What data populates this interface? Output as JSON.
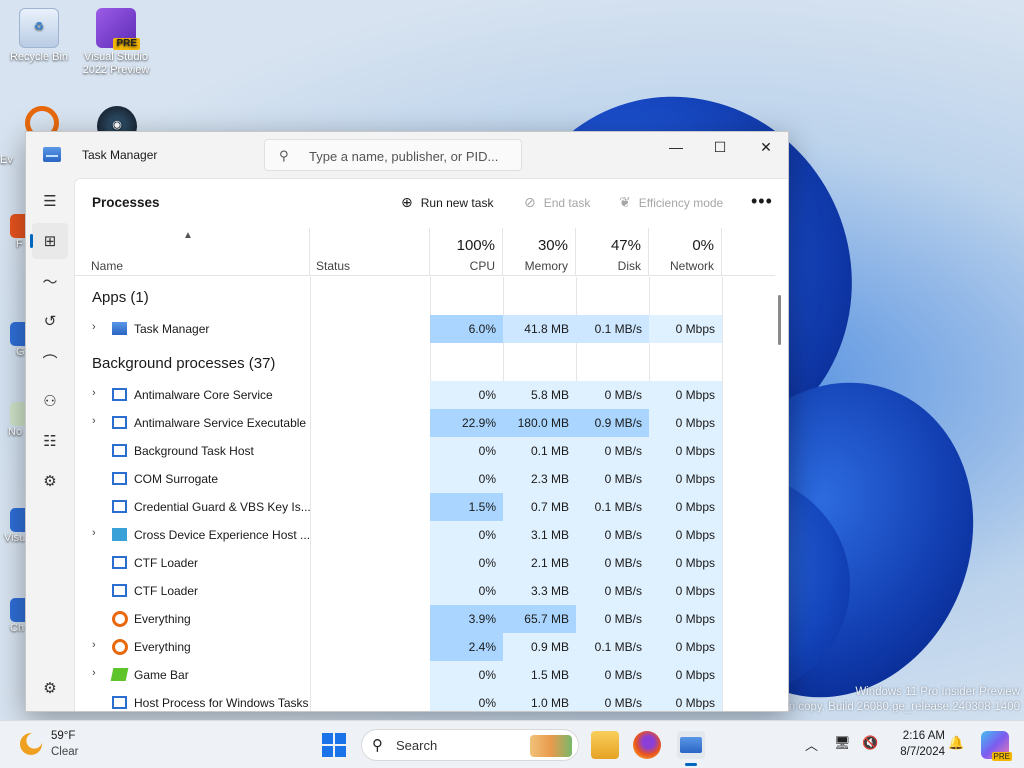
{
  "desktop": {
    "icons": [
      {
        "label": "Recycle Bin"
      },
      {
        "label": "Visual Studio 2022 Preview",
        "badge": "PRE"
      }
    ],
    "peek_labels": [
      "Ev",
      "F",
      "G",
      "No",
      "Visu",
      "Ch"
    ],
    "watermark": {
      "line1": "Windows 11 Pro Insider Preview",
      "line2": "n copy. Build 26080.ge_release.240308-1400"
    }
  },
  "window": {
    "title": "Task Manager",
    "search_placeholder": "Type a name, publisher, or PID...",
    "controls": {
      "minimize": "—",
      "maximize": "☐",
      "close": "✕"
    }
  },
  "sidebar": {
    "items": [
      {
        "icon": "hamburger-icon"
      },
      {
        "icon": "processes-icon",
        "active": true
      },
      {
        "icon": "performance-icon"
      },
      {
        "icon": "app-history-icon"
      },
      {
        "icon": "startup-apps-icon"
      },
      {
        "icon": "users-icon"
      },
      {
        "icon": "details-icon"
      },
      {
        "icon": "services-icon"
      },
      {
        "icon": "settings-icon"
      }
    ]
  },
  "toolbar": {
    "page_title": "Processes",
    "run_new_task": "Run new task",
    "end_task": "End task",
    "efficiency_mode": "Efficiency mode",
    "more": "•••"
  },
  "columns": {
    "name": "Name",
    "status": "Status",
    "cpu": {
      "pct": "100%",
      "label": "CPU"
    },
    "memory": {
      "pct": "30%",
      "label": "Memory"
    },
    "disk": {
      "pct": "47%",
      "label": "Disk"
    },
    "network": {
      "pct": "0%",
      "label": "Network"
    }
  },
  "sections": {
    "apps": "Apps (1)",
    "background": "Background processes (37)"
  },
  "apps": [
    {
      "name": "Task Manager",
      "expandable": true,
      "icon": "task-manager",
      "cpu": "6.0%",
      "memory": "41.8 MB",
      "disk": "0.1 MB/s",
      "network": "0 Mbps",
      "heat": [
        "#a9d5ff",
        "#cce7ff",
        "#cce7ff",
        "#dff0ff"
      ]
    }
  ],
  "background": [
    {
      "name": "Antimalware Core Service",
      "expandable": true,
      "icon": "window",
      "cpu": "0%",
      "memory": "5.8 MB",
      "disk": "0 MB/s",
      "network": "0 Mbps",
      "heat": [
        "#dff0ff",
        "#dff0ff",
        "#dff0ff",
        "#dff0ff"
      ]
    },
    {
      "name": "Antimalware Service Executable",
      "expandable": true,
      "icon": "window",
      "cpu": "22.9%",
      "memory": "180.0 MB",
      "disk": "0.9 MB/s",
      "network": "0 Mbps",
      "heat": [
        "#a9d5ff",
        "#a9d5ff",
        "#a9d5ff",
        "#dff0ff"
      ]
    },
    {
      "name": "Background Task Host",
      "expandable": false,
      "icon": "window",
      "cpu": "0%",
      "memory": "0.1 MB",
      "disk": "0 MB/s",
      "network": "0 Mbps",
      "heat": [
        "#dff0ff",
        "#dff0ff",
        "#dff0ff",
        "#dff0ff"
      ]
    },
    {
      "name": "COM Surrogate",
      "expandable": false,
      "icon": "window",
      "cpu": "0%",
      "memory": "2.3 MB",
      "disk": "0 MB/s",
      "network": "0 Mbps",
      "heat": [
        "#dff0ff",
        "#dff0ff",
        "#dff0ff",
        "#dff0ff"
      ]
    },
    {
      "name": "Credential Guard & VBS Key Is...",
      "expandable": false,
      "icon": "window",
      "cpu": "1.5%",
      "memory": "0.7 MB",
      "disk": "0.1 MB/s",
      "network": "0 Mbps",
      "heat": [
        "#a9d5ff",
        "#dff0ff",
        "#dff0ff",
        "#dff0ff"
      ]
    },
    {
      "name": "Cross Device Experience Host ...",
      "expandable": true,
      "icon": "cross-device",
      "cpu": "0%",
      "memory": "3.1 MB",
      "disk": "0 MB/s",
      "network": "0 Mbps",
      "heat": [
        "#dff0ff",
        "#dff0ff",
        "#dff0ff",
        "#dff0ff"
      ]
    },
    {
      "name": "CTF Loader",
      "expandable": false,
      "icon": "window",
      "cpu": "0%",
      "memory": "2.1 MB",
      "disk": "0 MB/s",
      "network": "0 Mbps",
      "heat": [
        "#dff0ff",
        "#dff0ff",
        "#dff0ff",
        "#dff0ff"
      ]
    },
    {
      "name": "CTF Loader",
      "expandable": false,
      "icon": "window",
      "cpu": "0%",
      "memory": "3.3 MB",
      "disk": "0 MB/s",
      "network": "0 Mbps",
      "heat": [
        "#dff0ff",
        "#dff0ff",
        "#dff0ff",
        "#dff0ff"
      ]
    },
    {
      "name": "Everything",
      "expandable": false,
      "icon": "everything",
      "cpu": "3.9%",
      "memory": "65.7 MB",
      "disk": "0 MB/s",
      "network": "0 Mbps",
      "heat": [
        "#a9d5ff",
        "#a9d5ff",
        "#dff0ff",
        "#dff0ff"
      ]
    },
    {
      "name": "Everything",
      "expandable": true,
      "icon": "everything",
      "cpu": "2.4%",
      "memory": "0.9 MB",
      "disk": "0.1 MB/s",
      "network": "0 Mbps",
      "heat": [
        "#a9d5ff",
        "#dff0ff",
        "#dff0ff",
        "#dff0ff"
      ]
    },
    {
      "name": "Game Bar",
      "expandable": true,
      "icon": "game-bar",
      "cpu": "0%",
      "memory": "1.5 MB",
      "disk": "0 MB/s",
      "network": "0 Mbps",
      "heat": [
        "#dff0ff",
        "#dff0ff",
        "#dff0ff",
        "#dff0ff"
      ]
    },
    {
      "name": "Host Process for Windows Tasks",
      "expandable": false,
      "icon": "window",
      "cpu": "0%",
      "memory": "1.0 MB",
      "disk": "0 MB/s",
      "network": "0 Mbps",
      "heat": [
        "#dff0ff",
        "#dff0ff",
        "#dff0ff",
        "#dff0ff"
      ]
    }
  ],
  "taskbar": {
    "weather": {
      "temp": "59°F",
      "condition": "Clear"
    },
    "search_label": "Search",
    "apps": [
      {
        "name": "file-explorer-icon",
        "color": "#f4b73c"
      },
      {
        "name": "firefox-icon",
        "color": "#e8531f"
      },
      {
        "name": "task-manager-icon",
        "color": "#2a65c4"
      }
    ],
    "time": "2:16 AM",
    "date": "8/7/2024",
    "copilot_badge": "PRE"
  }
}
